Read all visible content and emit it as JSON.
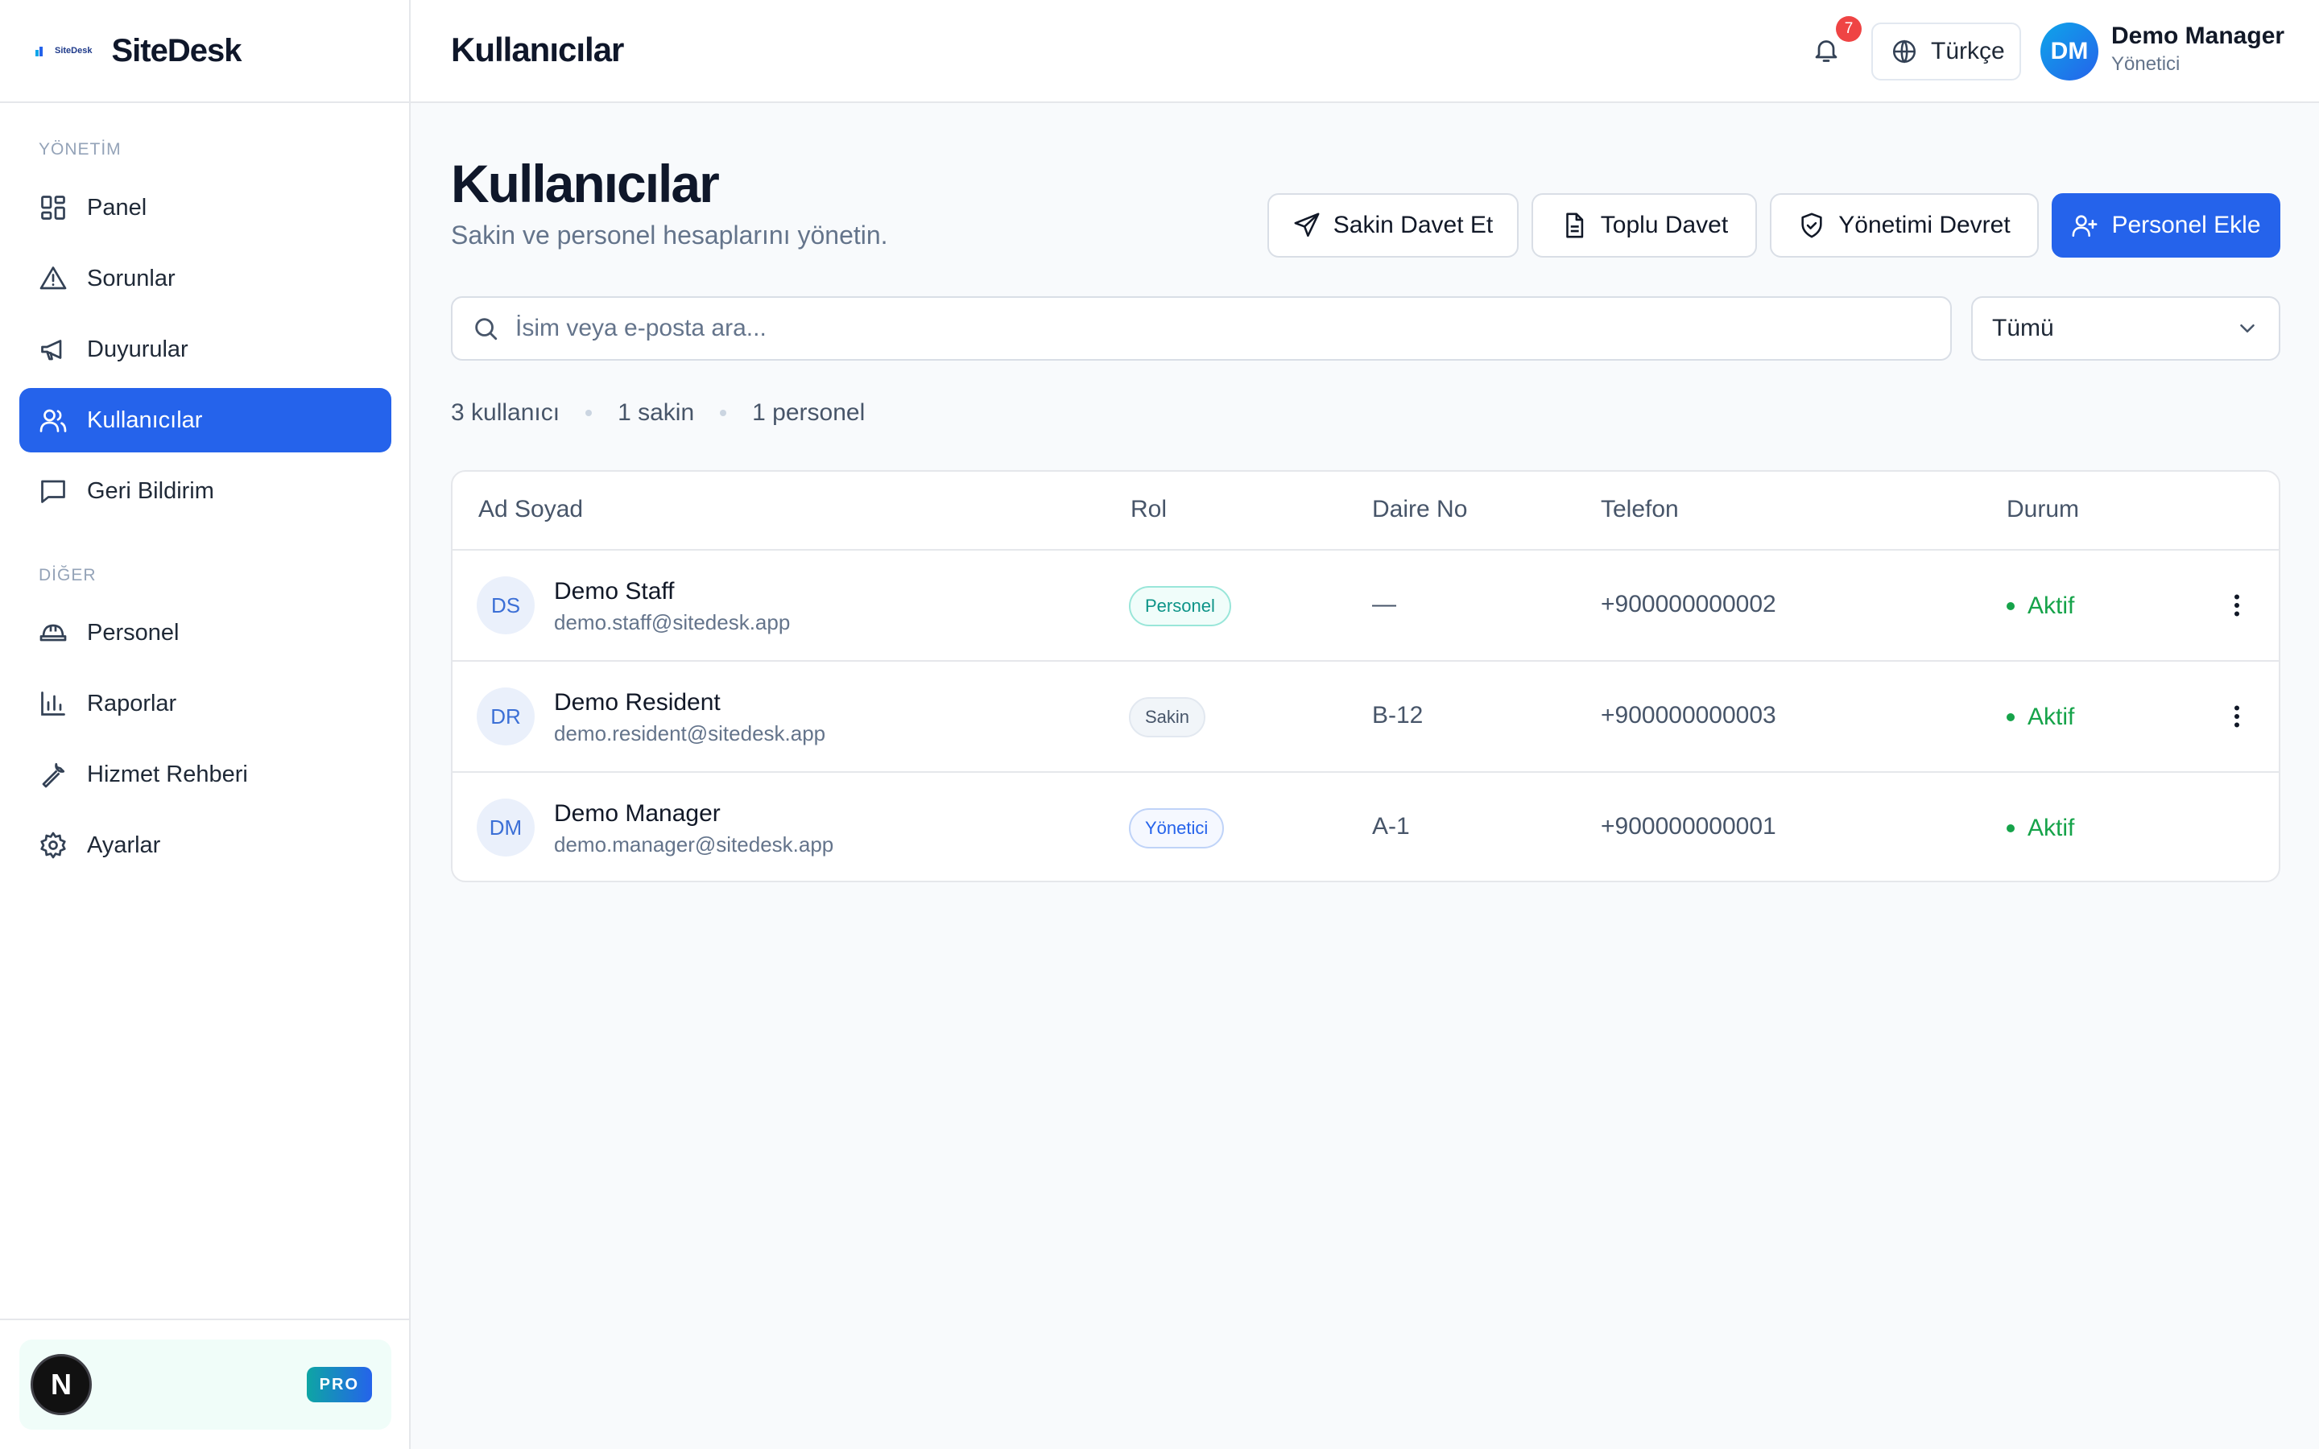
{
  "brand": {
    "logo_text": "SiteDesk",
    "name": "SiteDesk"
  },
  "sidebar": {
    "section_management": "YÖNETİM",
    "section_other": "DİĞER",
    "items": [
      {
        "label": "Panel",
        "icon": "dashboard-icon"
      },
      {
        "label": "Sorunlar",
        "icon": "warning-icon"
      },
      {
        "label": "Duyurular",
        "icon": "megaphone-icon"
      },
      {
        "label": "Kullanıcılar",
        "icon": "users-icon",
        "active": true
      },
      {
        "label": "Geri Bildirim",
        "icon": "message-icon"
      },
      {
        "label": "Personel",
        "icon": "hardhat-icon"
      },
      {
        "label": "Raporlar",
        "icon": "bar-chart-icon"
      },
      {
        "label": "Hizmet Rehberi",
        "icon": "wrench-icon"
      },
      {
        "label": "Ayarlar",
        "icon": "gear-icon"
      }
    ],
    "footer": {
      "avatar_letter": "N",
      "badge": "PRO"
    }
  },
  "header": {
    "title": "Kullanıcılar",
    "notifications_count": "7",
    "language": "Türkçe",
    "user": {
      "initials": "DM",
      "name": "Demo Manager",
      "role": "Yönetici"
    }
  },
  "main": {
    "title": "Kullanıcılar",
    "subtitle": "Sakin ve personel hesaplarını yönetin.",
    "actions": {
      "invite_resident": "Sakin Davet Et",
      "bulk_invite": "Toplu Davet",
      "transfer_management": "Yönetimi Devret",
      "add_staff": "Personel Ekle"
    },
    "search": {
      "placeholder": "İsim veya e-posta ara...",
      "value": ""
    },
    "filter": {
      "selected": "Tümü"
    },
    "counts": {
      "total": "3 kullanıcı",
      "residents": "1 sakin",
      "staff": "1 personel"
    },
    "table": {
      "columns": [
        "Ad Soyad",
        "Rol",
        "Daire No",
        "Telefon",
        "Durum"
      ],
      "rows": [
        {
          "initials": "DS",
          "name": "Demo Staff",
          "email": "demo.staff@sitedesk.app",
          "role": "Personel",
          "apartment": "—",
          "phone": "+900000000002",
          "status": "Aktif"
        },
        {
          "initials": "DR",
          "name": "Demo Resident",
          "email": "demo.resident@sitedesk.app",
          "role": "Sakin",
          "apartment": "B-12",
          "phone": "+900000000003",
          "status": "Aktif"
        },
        {
          "initials": "DM",
          "name": "Demo Manager",
          "email": "demo.manager@sitedesk.app",
          "role": "Yönetici",
          "apartment": "A-1",
          "phone": "+900000000001",
          "status": "Aktif"
        }
      ]
    }
  },
  "colors": {
    "accent": "#2563eb",
    "active_status": "#16a34a",
    "notification": "#ef4444"
  }
}
